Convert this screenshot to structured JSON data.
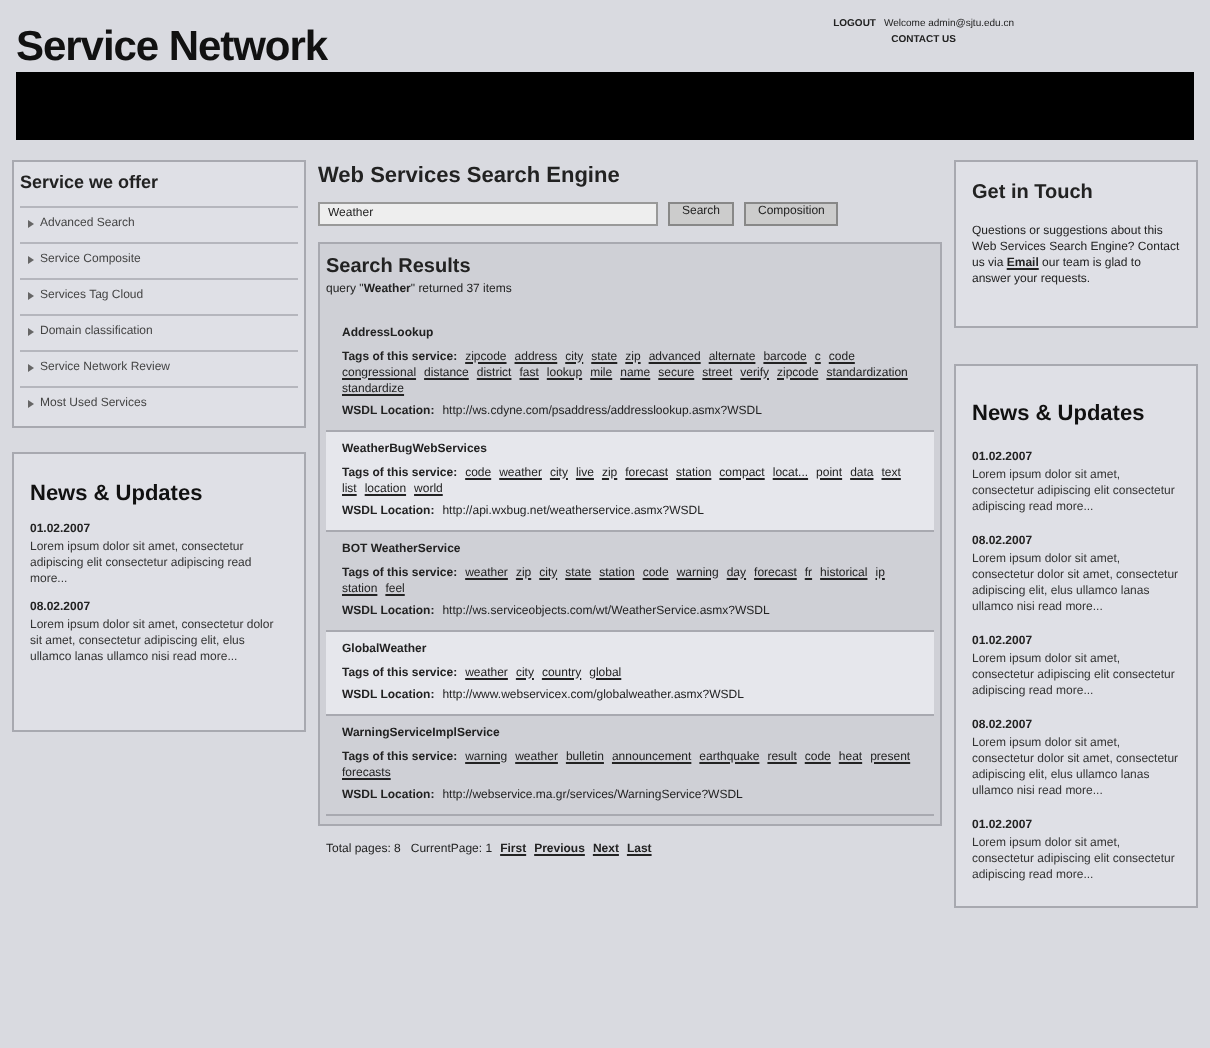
{
  "header": {
    "title": "Service Network",
    "logout": "LOGOUT",
    "welcome": "Welcome admin@sjtu.edu.cn",
    "contact": "CONTACT US"
  },
  "left": {
    "title": "Service we offer",
    "items": [
      "Advanced Search",
      "Service Composite",
      "Services Tag Cloud",
      "Domain classification",
      "Service Network Review",
      "Most Used Services"
    ]
  },
  "left_news": {
    "title": "News & Updates",
    "entries": [
      {
        "date": "01.02.2007",
        "text": "Lorem ipsum dolor sit amet, consectetur adipiscing elit consectetur adipiscing read more..."
      },
      {
        "date": "08.02.2007",
        "text": "Lorem ipsum dolor sit amet, consectetur dolor sit amet, consectetur adipiscing elit, elus ullamco lanas ullamco nisi read more..."
      }
    ]
  },
  "search": {
    "title": "Web Services Search Engine",
    "value": "Weather",
    "buttons": [
      "Search",
      "Composition"
    ]
  },
  "results": {
    "title": "Search Results",
    "summary": "query \"**Weather**\" returned 37 items",
    "items": [
      {
        "name": "AddressLookup",
        "tags_label": "Tags of this service:",
        "wsdl_label": "WSDL Location:",
        "tags": [
          "zipcode",
          "address",
          "city",
          "state",
          "zip",
          "advanced",
          "alternate",
          "barcode",
          "c",
          "code",
          "congressional",
          "distance",
          "district",
          "fast",
          "lookup",
          "mile",
          "name",
          "secure",
          "street",
          "verify",
          "zipcode",
          "standardization",
          "standardize"
        ],
        "wsdl": "http://ws.cdyne.com/psaddress/addresslookup.asmx?WSDL"
      },
      {
        "name": "WeatherBugWebServices",
        "tags_label": "Tags of this service:",
        "wsdl_label": "WSDL Location:",
        "tags": [
          "code",
          "weather",
          "city",
          "live",
          "zip",
          "forecast",
          "station",
          "compact",
          "locat...",
          "point",
          "data",
          "text",
          "list",
          "location",
          "world"
        ],
        "wsdl": "http://api.wxbug.net/weatherservice.asmx?WSDL"
      },
      {
        "name": "BOT WeatherService",
        "tags_label": "Tags of this service:",
        "wsdl_label": "WSDL Location:",
        "tags": [
          "weather",
          "zip",
          "city",
          "state",
          "station",
          "code",
          "warning",
          "day",
          "forecast",
          "fr",
          "historical",
          "ip",
          "station",
          "feel"
        ],
        "wsdl": "http://ws.serviceobjects.com/wt/WeatherService.asmx?WSDL"
      },
      {
        "name": "GlobalWeather",
        "tags_label": "Tags of this service:",
        "wsdl_label": "WSDL Location:",
        "tags": [
          "weather",
          "city",
          "country",
          "global"
        ],
        "wsdl": "http://www.webservicex.com/globalweather.asmx?WSDL"
      },
      {
        "name": "WarningServiceImplService",
        "tags_label": "Tags of this service:",
        "wsdl_label": "WSDL Location:",
        "tags": [
          "warning",
          "weather",
          "bulletin",
          "announcement",
          "earthquake",
          "result",
          "code",
          "heat",
          "present",
          "forecasts"
        ],
        "wsdl": "http://webservice.ma.gr/services/WarningService?WSDL"
      }
    ]
  },
  "pager": {
    "text": "Total pages: 8   CurrentPage: 1",
    "links": [
      "First",
      "Previous",
      "Next",
      "Last"
    ]
  },
  "contact": {
    "title": "Get in Touch",
    "text": "Questions or suggestions about this Web Services Search Engine? Contact us via",
    "link": "Email",
    "after": "our team is glad to answer your requests."
  },
  "right_news": {
    "title": "News & Updates",
    "entries": [
      {
        "date": "01.02.2007",
        "text": "Lorem ipsum dolor sit amet, consectetur adipiscing elit consectetur adipiscing read more..."
      },
      {
        "date": "08.02.2007",
        "text": "Lorem ipsum dolor sit amet, consectetur dolor sit amet, consectetur adipiscing elit, elus ullamco lanas ullamco nisi read more..."
      },
      {
        "date": "01.02.2007",
        "text": "Lorem ipsum dolor sit amet, consectetur adipiscing elit consectetur adipiscing read more..."
      },
      {
        "date": "08.02.2007",
        "text": "Lorem ipsum dolor sit amet, consectetur dolor sit amet, consectetur adipiscing elit, elus ullamco lanas ullamco nisi read more..."
      },
      {
        "date": "01.02.2007",
        "text": "Lorem ipsum dolor sit amet, consectetur adipiscing elit consectetur adipiscing read more..."
      }
    ]
  }
}
